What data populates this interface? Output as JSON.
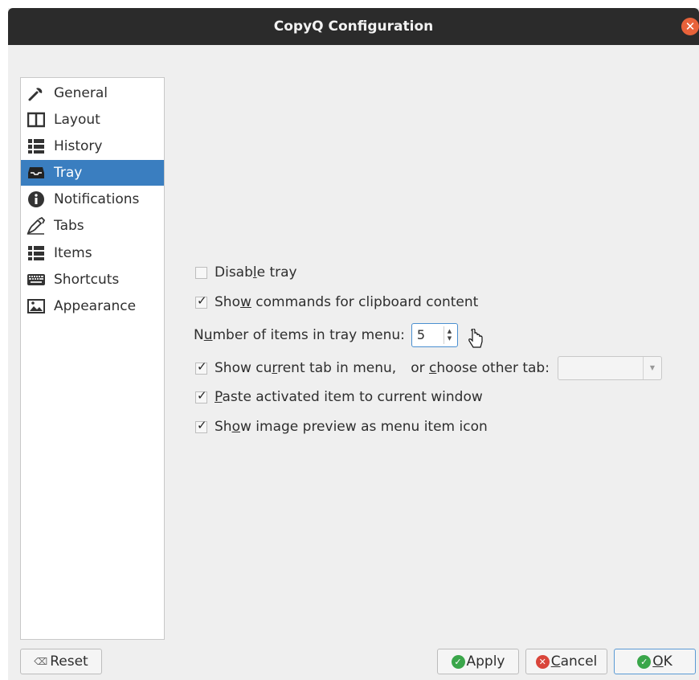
{
  "window": {
    "title": "CopyQ Configuration"
  },
  "sidebar": {
    "items": [
      {
        "label": "General",
        "icon": "wrench-icon"
      },
      {
        "label": "Layout",
        "icon": "layout-icon"
      },
      {
        "label": "History",
        "icon": "history-icon"
      },
      {
        "label": "Tray",
        "icon": "tray-icon",
        "selected": true
      },
      {
        "label": "Notifications",
        "icon": "info-icon"
      },
      {
        "label": "Tabs",
        "icon": "tabs-icon"
      },
      {
        "label": "Items",
        "icon": "items-icon"
      },
      {
        "label": "Shortcuts",
        "icon": "keyboard-icon"
      },
      {
        "label": "Appearance",
        "icon": "picture-icon"
      }
    ]
  },
  "tray": {
    "disable_tray": {
      "pre": "Disab",
      "key": "l",
      "post": "e tray",
      "checked": false
    },
    "show_commands": {
      "pre": "Sho",
      "key": "w",
      "post": " commands for clipboard content",
      "checked": true
    },
    "num_items": {
      "pre": "N",
      "key": "u",
      "post": "mber of items in tray menu:",
      "value": "5"
    },
    "show_current_tab": {
      "pre": "Show cu",
      "key": "r",
      "post": "rent tab in menu,",
      "checked": true
    },
    "choose_other_tab": {
      "pre": "or ",
      "key": "c",
      "post": "hoose other tab:",
      "value": ""
    },
    "paste_activated": {
      "pre": "",
      "key": "P",
      "post": "aste activated item to current window",
      "checked": true
    },
    "show_image_preview": {
      "pre": "Sh",
      "key": "o",
      "post": "w image preview as menu item icon",
      "checked": true
    }
  },
  "buttons": {
    "reset": "Reset",
    "apply": "Apply",
    "cancel_key": "C",
    "cancel_rest": "ancel",
    "ok_key": "O",
    "ok_rest": "K"
  },
  "colors": {
    "selection": "#3a7ec0",
    "titlebar": "#2b2b2b",
    "close": "#e8623a",
    "apply": "#3aa64a",
    "cancel": "#d9453a",
    "ok": "#3aa64a"
  }
}
